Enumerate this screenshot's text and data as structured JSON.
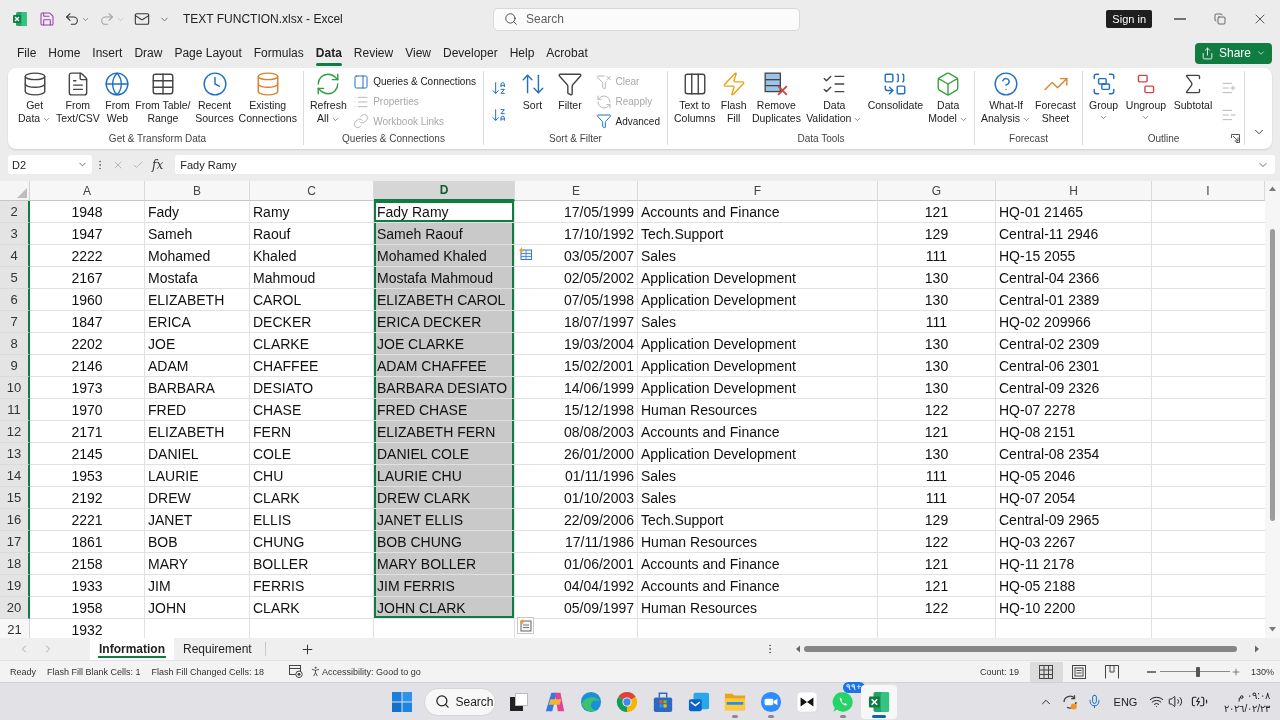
{
  "title_bar": {
    "quick_access": [
      {
        "disabled": false
      },
      {
        "disabled": false
      },
      {
        "disabled": true
      },
      {
        "disabled": false
      }
    ],
    "title": "TEXT FUNCTION.xlsx - Excel",
    "search": {
      "placeholder": "Search"
    },
    "sign_in": "Sign in"
  },
  "menu_tabs": [
    {
      "label": "File",
      "selected": false
    },
    {
      "label": "Home",
      "selected": false
    },
    {
      "label": "Insert",
      "selected": false
    },
    {
      "label": "Draw",
      "selected": false
    },
    {
      "label": "Page Layout",
      "selected": false
    },
    {
      "label": "Formulas",
      "selected": false
    },
    {
      "label": "Data",
      "selected": true
    },
    {
      "label": "Review",
      "selected": false
    },
    {
      "label": "View",
      "selected": false
    },
    {
      "label": "Developer",
      "selected": false
    },
    {
      "label": "Help",
      "selected": false
    },
    {
      "label": "Acrobat",
      "selected": false
    }
  ],
  "share_button": "Share",
  "ribbon": {
    "groups": [
      {
        "title": "Get & Transform Data",
        "launcher": false,
        "items": [
          {
            "kind": "large",
            "label": "Get Data",
            "dropdown": true
          },
          {
            "kind": "large",
            "label": "From Text/CSV",
            "dropdown": false
          },
          {
            "kind": "large",
            "label": "From Web",
            "dropdown": false
          },
          {
            "kind": "large",
            "label": "From Table/ Range",
            "dropdown": false
          },
          {
            "kind": "large",
            "label": "Recent Sources",
            "dropdown": false
          },
          {
            "kind": "large",
            "label": "Existing Connections",
            "dropdown": false
          }
        ]
      },
      {
        "title": "Queries & Connections",
        "launcher": false,
        "items": [
          {
            "kind": "large",
            "label": "Refresh All",
            "dropdown": true
          },
          {
            "kind": "stack",
            "items": [
              {
                "label": "Queries & Connections",
                "disabled": false
              },
              {
                "label": "Properties",
                "disabled": true
              },
              {
                "label": "Workbook Links",
                "disabled": true
              }
            ]
          }
        ]
      },
      {
        "title": "Sort & Filter",
        "launcher": false,
        "items": [
          {
            "kind": "stack",
            "items": [
              {
                "disabled": false
              },
              {
                "disabled": false
              }
            ]
          },
          {
            "kind": "large",
            "label": "Sort",
            "dropdown": false
          },
          {
            "kind": "large",
            "label": "Filter",
            "dropdown": false
          },
          {
            "kind": "stack",
            "items": [
              {
                "label": "Clear",
                "disabled": true
              },
              {
                "label": "Reapply",
                "disabled": true
              },
              {
                "label": "Advanced",
                "disabled": false
              }
            ]
          }
        ]
      },
      {
        "title": "Data Tools",
        "launcher": false,
        "items": [
          {
            "kind": "large",
            "label": "Text to Columns",
            "dropdown": false
          },
          {
            "kind": "large",
            "label": "Flash Fill",
            "dropdown": false
          },
          {
            "kind": "large",
            "label": "Remove Duplicates",
            "dropdown": false
          },
          {
            "kind": "large",
            "label": "Data Validation",
            "dropdown": true
          },
          {
            "kind": "large",
            "label": "Consolidate",
            "dropdown": false
          },
          {
            "kind": "large",
            "label": "Data Model",
            "dropdown": true
          }
        ]
      },
      {
        "title": "Forecast",
        "launcher": false,
        "items": [
          {
            "kind": "large",
            "label": "What-If Analysis",
            "dropdown": true
          },
          {
            "kind": "large",
            "label": "Forecast Sheet",
            "dropdown": false
          }
        ]
      },
      {
        "title": "Outline",
        "launcher": true,
        "items": [
          {
            "kind": "large",
            "label": "Group",
            "dropdown": true
          },
          {
            "kind": "large",
            "label": "Ungroup",
            "dropdown": true
          },
          {
            "kind": "large",
            "label": "Subtotal",
            "dropdown": false
          },
          {
            "kind": "stack",
            "items": [
              {
                "disabled": true
              },
              {
                "disabled": true
              }
            ]
          }
        ]
      }
    ]
  },
  "formula_bar": {
    "name_box": "D2",
    "function_label": "fx",
    "formula": "Fady Ramy"
  },
  "sheet": {
    "columns": [
      {
        "label": "A",
        "selected": false
      },
      {
        "label": "B",
        "selected": false
      },
      {
        "label": "C",
        "selected": false
      },
      {
        "label": "D",
        "selected": true
      },
      {
        "label": "E",
        "selected": false
      },
      {
        "label": "F",
        "selected": false
      },
      {
        "label": "G",
        "selected": false
      },
      {
        "label": "H",
        "selected": false
      },
      {
        "label": "I",
        "selected": false
      }
    ],
    "rows": [
      {
        "number": "2",
        "selected": true,
        "active": true,
        "cells": [
          "1948",
          "Fady",
          "Ramy",
          "Fady Ramy",
          "17/05/1999",
          "Accounts and Finance",
          "121",
          "HQ-01 21465"
        ]
      },
      {
        "number": "3",
        "selected": true,
        "active": false,
        "cells": [
          "1947",
          "Sameh",
          "Raouf",
          "Sameh Raouf",
          "17/10/1992",
          "Tech.Support",
          "129",
          "Central-11 2946"
        ]
      },
      {
        "number": "4",
        "selected": true,
        "active": false,
        "cells": [
          "2222",
          "Mohamed",
          "Khaled",
          "Mohamed Khaled",
          "03/05/2007",
          "Sales",
          "111",
          "HQ-15 2055"
        ]
      },
      {
        "number": "5",
        "selected": true,
        "active": false,
        "cells": [
          "2167",
          "Mostafa",
          "Mahmoud",
          "Mostafa Mahmoud",
          "02/05/2002",
          "Application Development",
          "130",
          "Central-04 2366"
        ]
      },
      {
        "number": "6",
        "selected": true,
        "active": false,
        "cells": [
          "1960",
          "ELIZABETH",
          "CAROL",
          "ELIZABETH CAROL",
          "07/05/1998",
          "Application Development",
          "130",
          "Central-01 2389"
        ]
      },
      {
        "number": "7",
        "selected": true,
        "active": false,
        "cells": [
          "1847",
          "ERICA",
          "DECKER",
          "ERICA DECKER",
          "18/07/1997",
          "Sales",
          "111",
          "HQ-02 209966"
        ]
      },
      {
        "number": "8",
        "selected": true,
        "active": false,
        "cells": [
          "2202",
          "JOE",
          "CLARKE",
          "JOE CLARKE",
          "19/03/2004",
          "Application Development",
          "130",
          "Central-02 2309"
        ]
      },
      {
        "number": "9",
        "selected": true,
        "active": false,
        "cells": [
          "2146",
          "ADAM",
          "CHAFFEE",
          "ADAM CHAFFEE",
          "15/02/2001",
          "Application Development",
          "130",
          "Central-06 2301"
        ]
      },
      {
        "number": "10",
        "selected": true,
        "active": false,
        "cells": [
          "1973",
          "BARBARA",
          "DESIATO",
          "BARBARA DESIATO",
          "14/06/1999",
          "Application Development",
          "130",
          "Central-09 2326"
        ]
      },
      {
        "number": "11",
        "selected": true,
        "active": false,
        "cells": [
          "1970",
          "FRED",
          "CHASE",
          "FRED CHASE",
          "15/12/1998",
          "Human Resources",
          "122",
          "HQ-07 2278"
        ]
      },
      {
        "number": "12",
        "selected": true,
        "active": false,
        "cells": [
          "2171",
          "ELIZABETH",
          "FERN",
          "ELIZABETH FERN",
          "08/08/2003",
          "Accounts and Finance",
          "121",
          "HQ-08 2151"
        ]
      },
      {
        "number": "13",
        "selected": true,
        "active": false,
        "cells": [
          "2145",
          "DANIEL",
          "COLE",
          "DANIEL COLE",
          "26/01/2000",
          "Application Development",
          "130",
          "Central-08 2354"
        ]
      },
      {
        "number": "14",
        "selected": true,
        "active": false,
        "cells": [
          "1953",
          "LAURIE",
          "CHU",
          "LAURIE CHU",
          "01/11/1996",
          "Sales",
          "111",
          "HQ-05 2046"
        ]
      },
      {
        "number": "15",
        "selected": true,
        "active": false,
        "cells": [
          "2192",
          "DREW",
          "CLARK",
          "DREW CLARK",
          "01/10/2003",
          "Sales",
          "111",
          "HQ-07 2054"
        ]
      },
      {
        "number": "16",
        "selected": true,
        "active": false,
        "cells": [
          "2221",
          "JANET",
          "ELLIS",
          "JANET ELLIS",
          "22/09/2006",
          "Tech.Support",
          "129",
          "Central-09 2965"
        ]
      },
      {
        "number": "17",
        "selected": true,
        "active": false,
        "cells": [
          "1861",
          "BOB",
          "CHUNG",
          "BOB CHUNG",
          "17/11/1986",
          "Human Resources",
          "122",
          "HQ-03 2267"
        ]
      },
      {
        "number": "18",
        "selected": true,
        "active": false,
        "cells": [
          "2158",
          "MARY",
          "BOLLER",
          "MARY BOLLER",
          "01/06/2001",
          "Accounts and Finance",
          "121",
          "HQ-11 2178"
        ]
      },
      {
        "number": "19",
        "selected": true,
        "active": false,
        "cells": [
          "1933",
          "JIM",
          "FERRIS",
          "JIM FERRIS",
          "04/04/1992",
          "Accounts and Finance",
          "121",
          "HQ-05 2188"
        ]
      },
      {
        "number": "20",
        "selected": true,
        "active": false,
        "cells": [
          "1958",
          "JOHN",
          "CLARK",
          "JOHN CLARK",
          "05/09/1997",
          "Human Resources",
          "122",
          "HQ-10 2200"
        ]
      },
      {
        "number": "21",
        "selected": false,
        "active": false,
        "cells": [
          "1932"
        ]
      }
    ]
  },
  "sheet_tabs": [
    {
      "label": "Information",
      "selected": true
    },
    {
      "label": "Requirement",
      "selected": false
    }
  ],
  "status_bar": {
    "items": [
      "Ready",
      "Flash Fill Blank Cells: 1",
      "Flash Fill Changed Cells: 18"
    ],
    "accessibility": "Accessibility: Good to go",
    "count": "Count: 19",
    "views": [
      {
        "selected": true
      },
      {
        "selected": false
      },
      {
        "selected": false
      }
    ],
    "zoom": {
      "level": 0.55,
      "reading": "130%"
    }
  },
  "taskbar": {
    "search": "Search",
    "apps": [
      {
        "running": false,
        "active": false
      },
      {
        "running": false,
        "active": false
      },
      {
        "running": false,
        "active": false
      },
      {
        "running": false,
        "active": false
      },
      {
        "running": false,
        "active": false
      },
      {
        "running": false,
        "active": false
      },
      {
        "running": true,
        "active": false
      },
      {
        "running": true,
        "active": false
      },
      {
        "running": false,
        "active": false
      },
      {
        "running": true,
        "active": false,
        "badge": "٩٩+"
      },
      {
        "running": true,
        "active": true
      }
    ],
    "tray": {
      "language": "ENG",
      "time": "٠٩:٠٨ م",
      "date": "٢٠٢٦/٠٢/٢٣"
    }
  }
}
